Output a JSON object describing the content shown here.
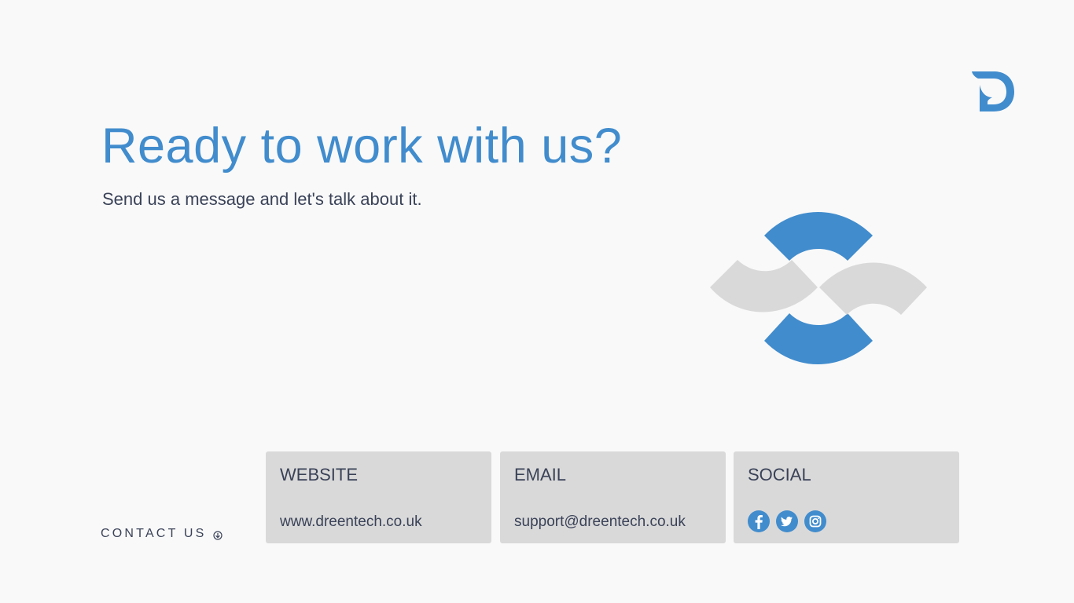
{
  "colors": {
    "background": "#f9f9f9",
    "accent": "#418ccd",
    "text": "#3a4258",
    "card": "#d9d9d9",
    "graphic_gray": "#d9d9d9"
  },
  "logo": {
    "icon": "d-letter-logo-icon"
  },
  "hero": {
    "title": "Ready to work with us?",
    "subtitle": "Send us a message and let's talk about it."
  },
  "contact": {
    "label": "CONTACT US",
    "icon": "arrow-down-circle-icon"
  },
  "cards": {
    "website": {
      "title": "WEBSITE",
      "value": "www.dreentech.co.uk"
    },
    "email": {
      "title": "EMAIL",
      "value": "support@dreentech.co.uk"
    },
    "social": {
      "title": "SOCIAL",
      "icons": [
        "facebook-icon",
        "twitter-icon",
        "instagram-icon"
      ]
    }
  }
}
